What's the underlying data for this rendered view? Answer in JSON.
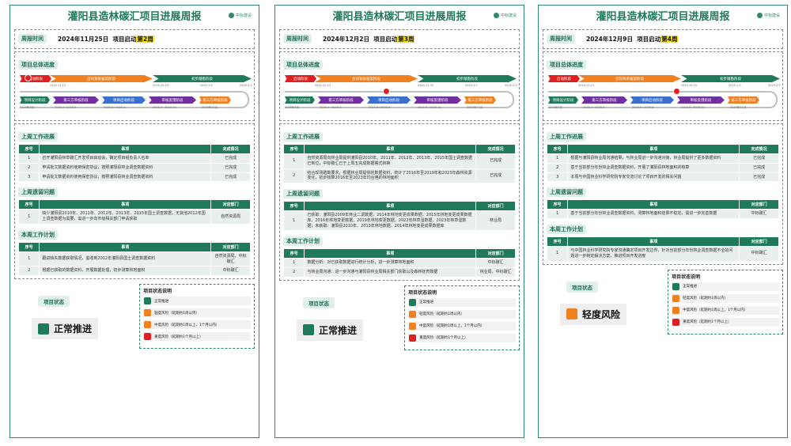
{
  "colors": {
    "green": "#1f7a5a",
    "red": "#e02020",
    "orange": "#f08020",
    "blue": "#3a6fd0",
    "purple": "#7030a0",
    "yellow": "#ffe600"
  },
  "logo": "中标建设",
  "common": {
    "title": "灌阳县造林碳汇项目进展周报",
    "week_label": "周报时间",
    "progress_label": "项目总体进度",
    "col_seq": "序号",
    "col_item": "事项",
    "col_status": "完成情况",
    "col_dept": "对应部门",
    "status_label": "项目状态",
    "legend": {
      "title": "项目状态说明",
      "items": [
        "正常推进",
        "轻度风险（延期约1周以内）",
        "中度风险（延期约1周以上，1个月以内）",
        "重度风险（延期约1个月以上）"
      ]
    },
    "timeline": {
      "top": [
        "启动阶段",
        "合同系统备案阶段",
        "初步踏勘阶段"
      ],
      "bottom": [
        "项目设计阶段",
        "第三方审核阶段",
        "项目启动阶段",
        "审核反馈阶段",
        "第三方审核阶段"
      ],
      "dates_top": [
        "2024.11.13",
        "2024.12.25",
        "2025.1.5",
        "2025.2.5"
      ],
      "dates_bottom": [
        "2025年3月",
        "2025.4~2025.5",
        "2025.6~2025.8",
        "2025.9~2025.10",
        "2025年11月"
      ]
    }
  },
  "pages": [
    {
      "date": "2024年11月25日",
      "start": "项目启动",
      "week": "第2周",
      "sec1": "上周工作进展",
      "t1": [
        [
          "1",
          "召开灌阳县林草碳汇开发项目启动会，确定项目组负责人名单",
          "已完成"
        ],
        [
          "2",
          "申请批文数据资料使用保密协议，按照灌阳县林业调查数据资料",
          "已完成"
        ],
        [
          "3",
          "申请批文数据资料使用保密协议，按照灌阳县林业调查数据资料",
          "已完成"
        ]
      ],
      "sec2": "上周遗留问题",
      "t2": [
        [
          "1",
          "缺少灌阳县2010年、2011年、2012年、2013年、2015年国土调查数据，无其他2012年国土调查数据为需要，需进一步向市级相关部门申请获取",
          "自然资源局"
        ]
      ],
      "sec3": "本周工作计划",
      "t3": [
        [
          "1",
          "跟进缺失数据获取情况，需收到2012年灌阳县国土调查数据资料",
          "自然资源局、中标碳汇"
        ],
        [
          "2",
          "根据已获取的数据资料，开展数据处理，初步测算林地面积",
          "中标碳汇"
        ]
      ],
      "status": "正常推进"
    },
    {
      "date": "2024年12月2日",
      "start": "项目启动",
      "week": "第3周",
      "sec1": "上周工作进展",
      "t1": [
        [
          "1",
          "自然资源局向林业局提供灌阳县2010年、2011年、2012年、2013年、2015年国土调查数据已到位，中标碳汇已于上周五完成数据格式转换",
          "已完成"
        ],
        [
          "2",
          "结合现场踏勘要求，根据林业局提供的数据资料，统计了2016年至2019年和2023年森林资源变化，初步核算2016年至2023年均合格的林地面积",
          "已完成"
        ]
      ],
      "sec2": "上周遗留问题",
      "t2": [
        [
          "1",
          "已获取：灌阳县2009年林业二调数据，2014年林地变更成果数据，2015年林地变更成果数据库，2016年林地变更数据，2019年林地变更数据，2022年林草湿数据，2023年林草湿数据；未获取：灌阳县2010年、2013年林地数据，2014年林地变更成果数据库",
          "林业局"
        ]
      ],
      "sec3": "本周工作计划",
      "t3": [
        [
          "1",
          "数据分析：对已获取数据进行统计分析，进一步测算林地面积",
          "中标碳汇"
        ],
        [
          "2",
          "与林业局沟通：进一步沟通与灌阳县林业局相关部门获取以及森林抚育数据",
          "林业局、中标碳汇"
        ]
      ],
      "status": "正常推进"
    },
    {
      "date": "2024年12月9日",
      "start": "项目启动",
      "week": "第4周",
      "sec1": "上周工作进展",
      "t1": [
        [
          "1",
          "根据与灌阳县林业局沟通结果，与林业局进一步沟通对接，林业局提供了更多数据资料",
          "已完成"
        ],
        [
          "2",
          "基于当前部分年份林业调查数据资料，开展了灌阳县林地面积的核算",
          "已完成"
        ],
        [
          "3",
          "本周与中国林业科学研究院专家交流讨论了项目开发的相关问题",
          "已完成"
        ]
      ],
      "sec2": "上周遗留问题",
      "t2": [
        [
          "1",
          "基于当前部分年份林业调查数据资料，测算林地面积结果不稳定，需进一步完善数据",
          "中标碳汇"
        ]
      ],
      "sec3": "本周工作计划",
      "t3": [
        [
          "1",
          "与中国林业科学研究院专家沟通确定项目开发边界，针对当前部分年份林业调查数据不全的问题进一步制定解决方案，推进项目开发进度",
          "中标碳汇"
        ]
      ],
      "status": "轻度风险"
    }
  ]
}
